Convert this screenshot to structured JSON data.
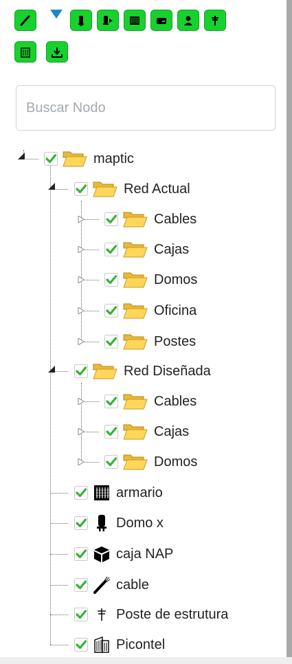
{
  "toolbar": {
    "buttons": [
      {
        "name": "draw-cable-button",
        "icon": "cable-icon"
      },
      {
        "name": "add-dome-button",
        "icon": "dome-icon"
      },
      {
        "name": "add-dome-arrow-button",
        "icon": "dome-arrow-icon"
      },
      {
        "name": "add-cabinet-button",
        "icon": "cabinet-icon"
      },
      {
        "name": "add-box-button",
        "icon": "box-icon"
      },
      {
        "name": "add-user-button",
        "icon": "user-icon"
      },
      {
        "name": "add-pole-button",
        "icon": "pole-icon"
      },
      {
        "name": "add-building-button",
        "icon": "building-icon"
      },
      {
        "name": "download-button",
        "icon": "download-icon"
      }
    ],
    "dropdown_icon": "triangle-down-icon",
    "accent_color": "#19d12e"
  },
  "search": {
    "placeholder": "Buscar Nodo",
    "value": ""
  },
  "tree": {
    "root": {
      "label": "maptic",
      "checked": true,
      "expanded": true
    },
    "red_actual": {
      "label": "Red Actual",
      "checked": true,
      "expanded": true,
      "children": [
        "Cables",
        "Cajas",
        "Domos",
        "Oficina",
        "Postes"
      ]
    },
    "red_disenada": {
      "label": "Red Diseñada",
      "checked": true,
      "expanded": true,
      "children": [
        "Cables",
        "Cajas",
        "Domos"
      ]
    },
    "leaves": [
      {
        "label": "armario",
        "icon": "cabinet-icon",
        "checked": true
      },
      {
        "label": "Domo x",
        "icon": "dome-icon",
        "checked": true
      },
      {
        "label": "caja NAP",
        "icon": "box-icon",
        "checked": true
      },
      {
        "label": "cable",
        "icon": "cable-icon",
        "checked": true
      },
      {
        "label": "Poste de estrutura",
        "icon": "pole-icon",
        "checked": true
      },
      {
        "label": "Picontel",
        "icon": "building-icon",
        "checked": true
      }
    ]
  }
}
